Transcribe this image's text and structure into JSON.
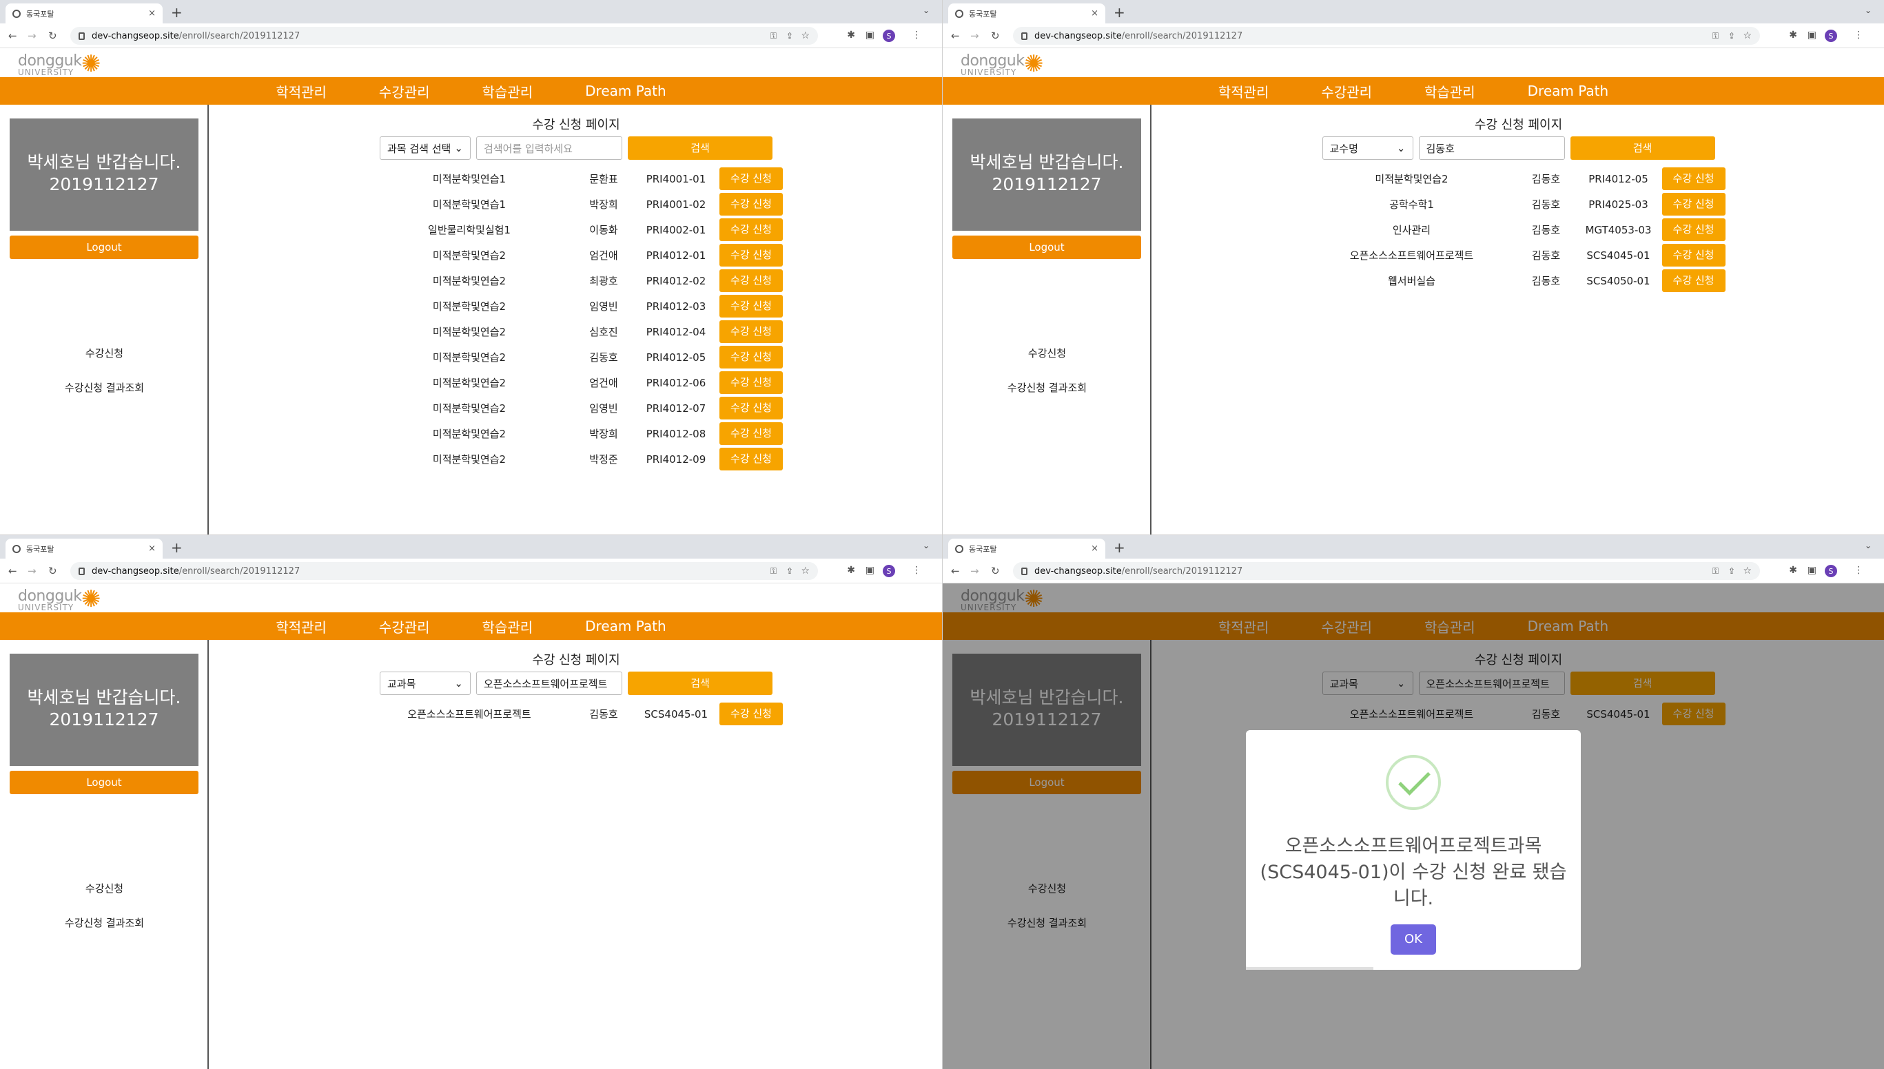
{
  "browser": {
    "tab_title": "동국포탈",
    "new_tab": "+",
    "tab_close": "×",
    "tab_menu": "⌄",
    "url_host": "dev-changseop.site",
    "url_path": "/enroll/search/2019112127",
    "profile_initial": "S"
  },
  "site": {
    "logo_word": "dongguk",
    "logo_sub": "UNIVERSITY",
    "nav": [
      "학적관리",
      "수강관리",
      "학습관리",
      "Dream Path"
    ],
    "welcome_line1": "박세호님 반갑습니다.",
    "welcome_line2": "2019112127",
    "logout": "Logout",
    "side_links": [
      "수강신청",
      "수강신청 결과조회"
    ],
    "page_title": "수강 신청 페이지",
    "search_button": "검색",
    "enroll_label": "수강 신청"
  },
  "panes": [
    {
      "select": "과목 검색 선택",
      "query": "",
      "placeholder": "검색어를 입력하세요",
      "rows": [
        {
          "name": "미적분학및연습1",
          "prof": "문환표",
          "code": "PRI4001-01"
        },
        {
          "name": "미적분학및연습1",
          "prof": "박장희",
          "code": "PRI4001-02"
        },
        {
          "name": "일반물리학및실험1",
          "prof": "이동화",
          "code": "PRI4002-01"
        },
        {
          "name": "미적분학및연습2",
          "prof": "엄건애",
          "code": "PRI4012-01"
        },
        {
          "name": "미적분학및연습2",
          "prof": "최광호",
          "code": "PRI4012-02"
        },
        {
          "name": "미적분학및연습2",
          "prof": "임영빈",
          "code": "PRI4012-03"
        },
        {
          "name": "미적분학및연습2",
          "prof": "심호진",
          "code": "PRI4012-04"
        },
        {
          "name": "미적분학및연습2",
          "prof": "김동호",
          "code": "PRI4012-05"
        },
        {
          "name": "미적분학및연습2",
          "prof": "엄건애",
          "code": "PRI4012-06"
        },
        {
          "name": "미적분학및연습2",
          "prof": "임영빈",
          "code": "PRI4012-07"
        },
        {
          "name": "미적분학및연습2",
          "prof": "박장희",
          "code": "PRI4012-08"
        },
        {
          "name": "미적분학및연습2",
          "prof": "박정준",
          "code": "PRI4012-09"
        }
      ]
    },
    {
      "select": "교수명",
      "query": "김동호",
      "placeholder": "",
      "rows": [
        {
          "name": "미적분학및연습2",
          "prof": "김동호",
          "code": "PRI4012-05"
        },
        {
          "name": "공학수학1",
          "prof": "김동호",
          "code": "PRI4025-03"
        },
        {
          "name": "인사관리",
          "prof": "김동호",
          "code": "MGT4053-03"
        },
        {
          "name": "오픈소스소프트웨어프로젝트",
          "prof": "김동호",
          "code": "SCS4045-01"
        },
        {
          "name": "웹서버실습",
          "prof": "김동호",
          "code": "SCS4050-01"
        }
      ]
    },
    {
      "select": "교과목",
      "query": "오픈소스소프트웨어프로젝트",
      "placeholder": "",
      "rows": [
        {
          "name": "오픈소스소프트웨어프로젝트",
          "prof": "김동호",
          "code": "SCS4045-01"
        }
      ]
    },
    {
      "select": "교과목",
      "query": "오픈소스소프트웨어프로젝트",
      "placeholder": "",
      "rows": [
        {
          "name": "오픈소스소프트웨어프로젝트",
          "prof": "김동호",
          "code": "SCS4045-01"
        }
      ]
    }
  ],
  "modal": {
    "message": "오픈소스소프트웨어프로젝트과목 (SCS4045-01)이 수강 신청 완료 됐습니다.",
    "ok": "OK"
  },
  "colors": {
    "brand_orange": "#f08a00",
    "button_orange": "#f7a400",
    "welcome_gray": "#7f7f7f",
    "ok_purple": "#7066e0"
  }
}
